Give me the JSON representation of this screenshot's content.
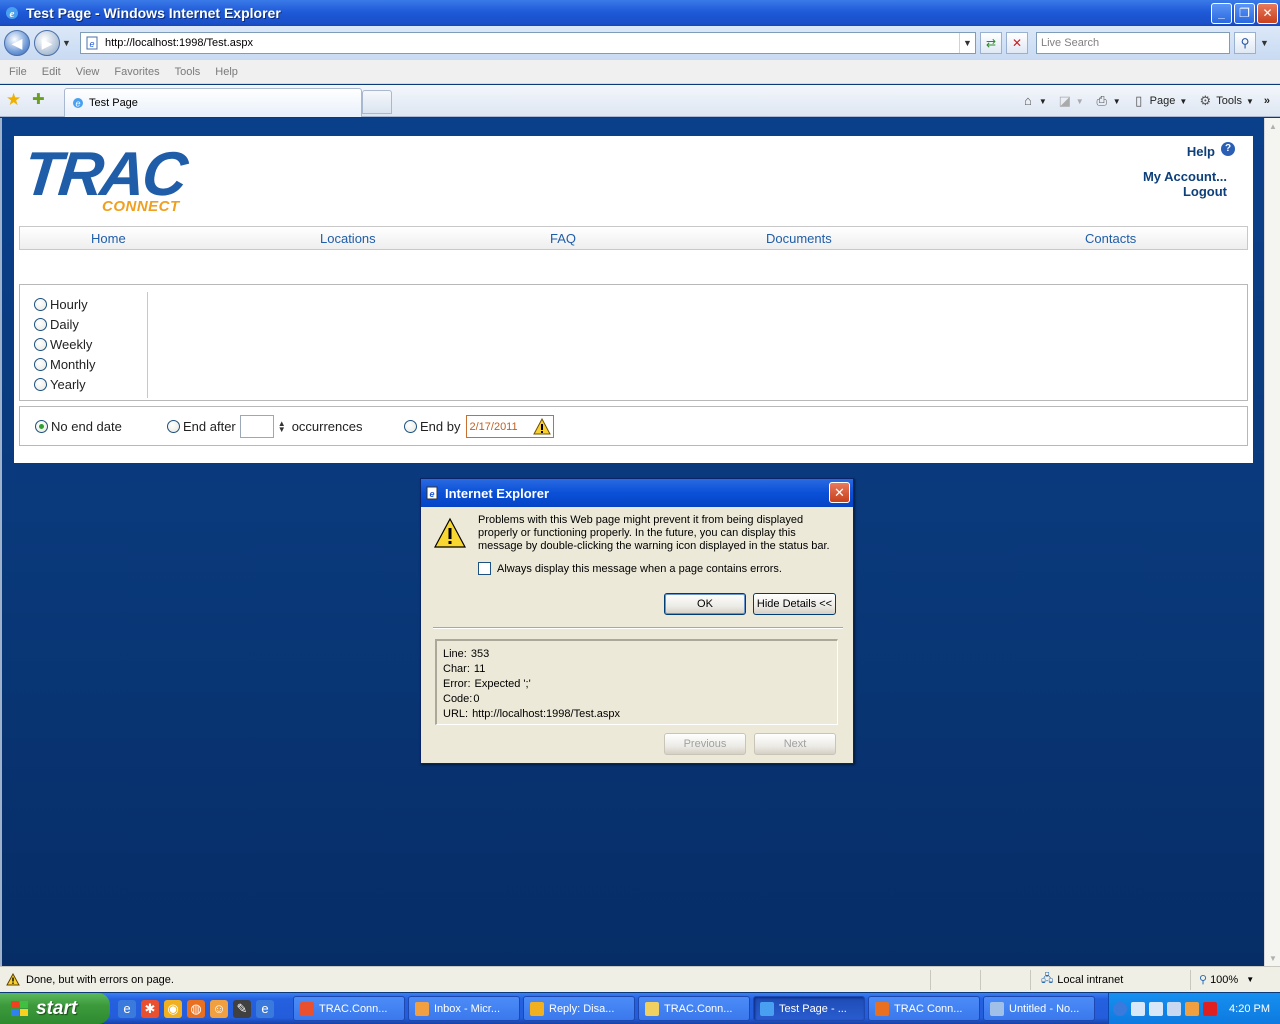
{
  "window": {
    "title": "Test Page - Windows Internet Explorer",
    "minimize": "_",
    "maximize": "❐",
    "close": "✕"
  },
  "address_bar": {
    "url": "http://localhost:1998/Test.aspx",
    "search_placeholder": "Live Search"
  },
  "menu": [
    "File",
    "Edit",
    "View",
    "Favorites",
    "Tools",
    "Help"
  ],
  "tab": {
    "label": "Test Page"
  },
  "command_bar": {
    "page_label": "Page",
    "tools_label": "Tools"
  },
  "site": {
    "logo_main": "TRAC",
    "logo_sub": "CONNECT",
    "help": "Help",
    "help_icon": "?",
    "account": "My Account...",
    "logout": "Logout",
    "nav": [
      "Home",
      "Locations",
      "FAQ",
      "Documents",
      "Contacts"
    ]
  },
  "recurrence": {
    "options": [
      "Hourly",
      "Daily",
      "Weekly",
      "Monthly",
      "Yearly"
    ],
    "no_end": "No end date",
    "end_after": "End after",
    "occurrences": "occurrences",
    "end_by": "End by",
    "end_by_date": "2/17/2011"
  },
  "dialog": {
    "title": "Internet Explorer",
    "message": "Problems with this Web page might prevent it from being displayed properly or functioning properly. In the future, you can display this message by double-clicking the warning icon displayed in the status bar.",
    "checkbox_label": "Always display this message when a page contains errors.",
    "ok": "OK",
    "hide_details": "Hide Details <<",
    "details": {
      "line_label": "Line:",
      "line": "353",
      "char_label": "Char:",
      "char": "11",
      "error_label": "Error:",
      "error": "Expected ';'",
      "code_label": "Code:",
      "code": "0",
      "url_label": "URL:",
      "url": "http://localhost:1998/Test.aspx"
    },
    "previous": "Previous",
    "next": "Next"
  },
  "status_bar": {
    "message": "Done, but with errors on page.",
    "zone": "Local intranet",
    "zoom": "100%"
  },
  "taskbar": {
    "start": "start",
    "tasks": [
      "TRAC.Conn...",
      "Inbox - Micr...",
      "Reply: Disa...",
      "TRAC.Conn...",
      "Test Page - ...",
      "TRAC Conn...",
      "Untitled - No..."
    ],
    "clock": "4:20 PM"
  },
  "colors": {
    "brand_blue": "#1f5da8",
    "brand_orange": "#f0a020",
    "page_bg": "#0a3a7a"
  }
}
